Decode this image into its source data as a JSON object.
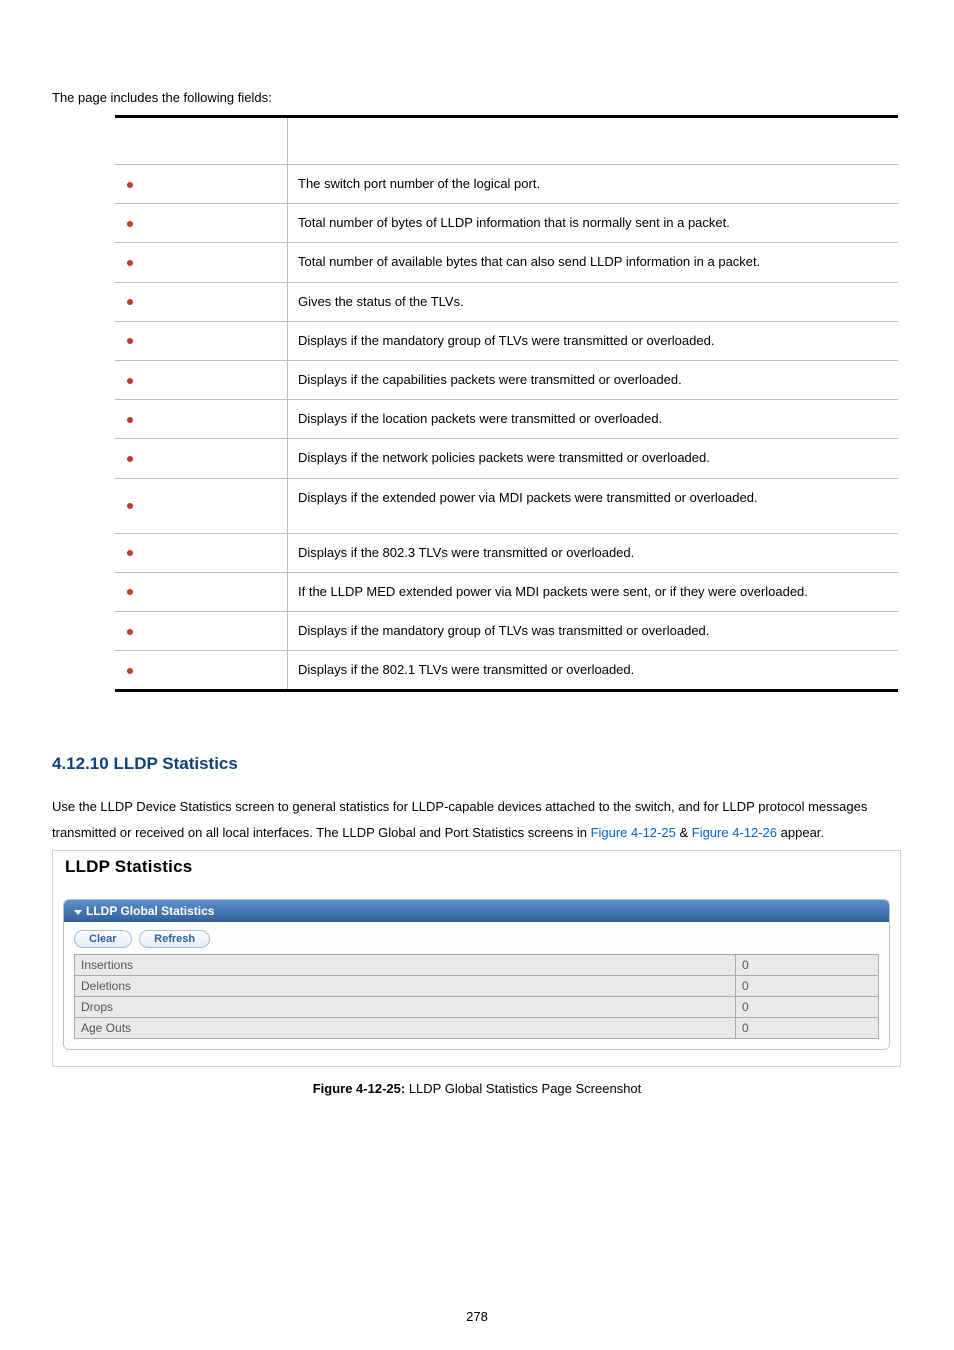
{
  "intro_text": "The page includes the following fields:",
  "table_rows": [
    {
      "obj": "",
      "desc": "The switch port number of the logical port."
    },
    {
      "obj": "",
      "desc": "Total number of bytes of LLDP information that is normally sent in a packet."
    },
    {
      "obj": "",
      "desc": "Total number of available bytes that can also send LLDP information in a packet."
    },
    {
      "obj": "",
      "desc": "Gives the status of the TLVs."
    },
    {
      "obj": "",
      "desc": "Displays if the mandatory group of TLVs were transmitted or overloaded."
    },
    {
      "obj": "",
      "desc": "Displays if the capabilities packets were transmitted or overloaded."
    },
    {
      "obj": "",
      "desc": "Displays if the location packets were transmitted or overloaded."
    },
    {
      "obj": "",
      "desc": "Displays if the network policies packets were transmitted or overloaded."
    },
    {
      "obj": "",
      "desc": "Displays if the extended power via MDI packets were transmitted or overloaded."
    },
    {
      "obj": "",
      "desc": "Displays if the 802.3 TLVs were transmitted or overloaded."
    },
    {
      "obj": "",
      "desc": "If the LLDP MED extended power via MDI packets were sent, or if they were overloaded."
    },
    {
      "obj": "",
      "desc": "Displays if the mandatory group of TLVs was transmitted or overloaded."
    },
    {
      "obj": "",
      "desc": "Displays if the 802.1 TLVs were transmitted or overloaded."
    }
  ],
  "section_heading": "4.12.10 LLDP Statistics",
  "paragraph_prefix": "Use the LLDP Device Statistics screen to general statistics for LLDP-capable devices attached to the switch, and for LLDP protocol messages transmitted or received on all local interfaces. The LLDP Global and Port Statistics screens in ",
  "fig_link_1": "Figure 4-12-25",
  "paragraph_mid": " & ",
  "fig_link_2": "Figure 4-12-26",
  "paragraph_suffix": " appear.",
  "shot": {
    "title": "LLDP Statistics",
    "panel_title": "LLDP Global Statistics",
    "clear_label": "Clear",
    "refresh_label": "Refresh",
    "rows": [
      {
        "label": "Insertions",
        "value": "0"
      },
      {
        "label": "Deletions",
        "value": "0"
      },
      {
        "label": "Drops",
        "value": "0"
      },
      {
        "label": "Age Outs",
        "value": "0"
      }
    ]
  },
  "caption_prefix": "Figure 4-12-25:",
  "caption_text": " LLDP Global Statistics Page Screenshot",
  "page_number": "278"
}
